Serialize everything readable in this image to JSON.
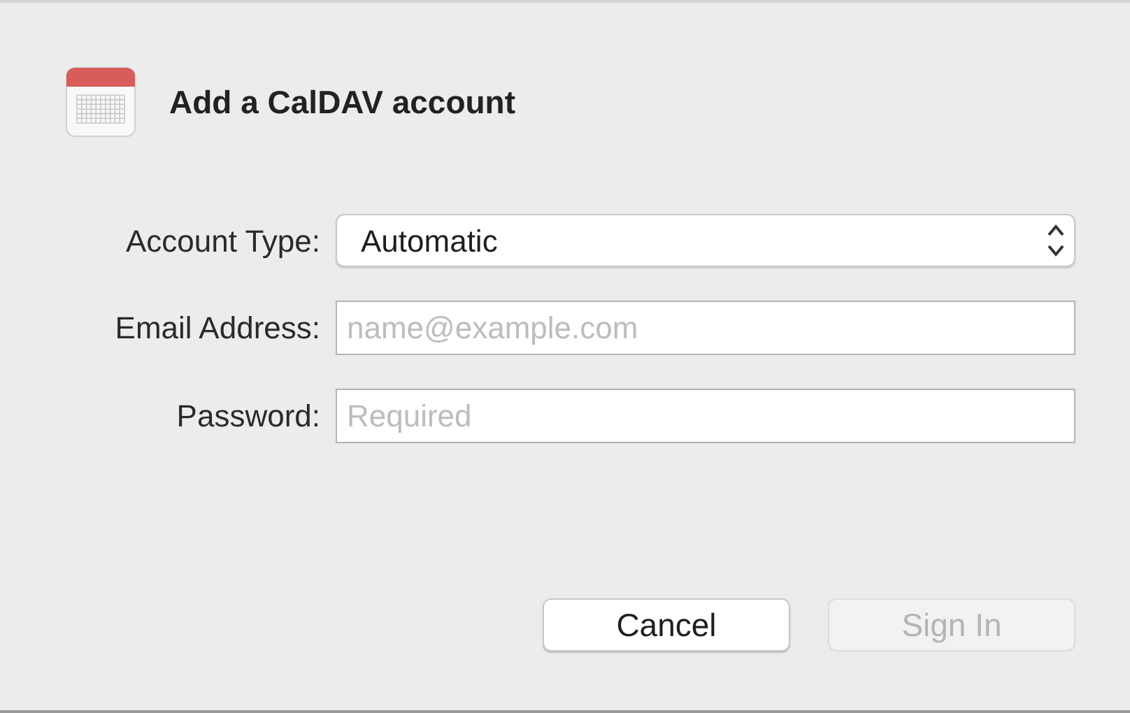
{
  "dialog": {
    "title": "Add a CalDAV account"
  },
  "fields": [
    {
      "kind": "select",
      "label": "Account Type:",
      "value": "Automatic"
    },
    {
      "kind": "text",
      "label": "Email Address:",
      "placeholder": "name@example.com"
    },
    {
      "kind": "text",
      "label": "Password:",
      "placeholder": "Required"
    }
  ],
  "buttons": [
    {
      "label": "Cancel",
      "disabled": false
    },
    {
      "label": "Sign In",
      "disabled": true
    }
  ]
}
